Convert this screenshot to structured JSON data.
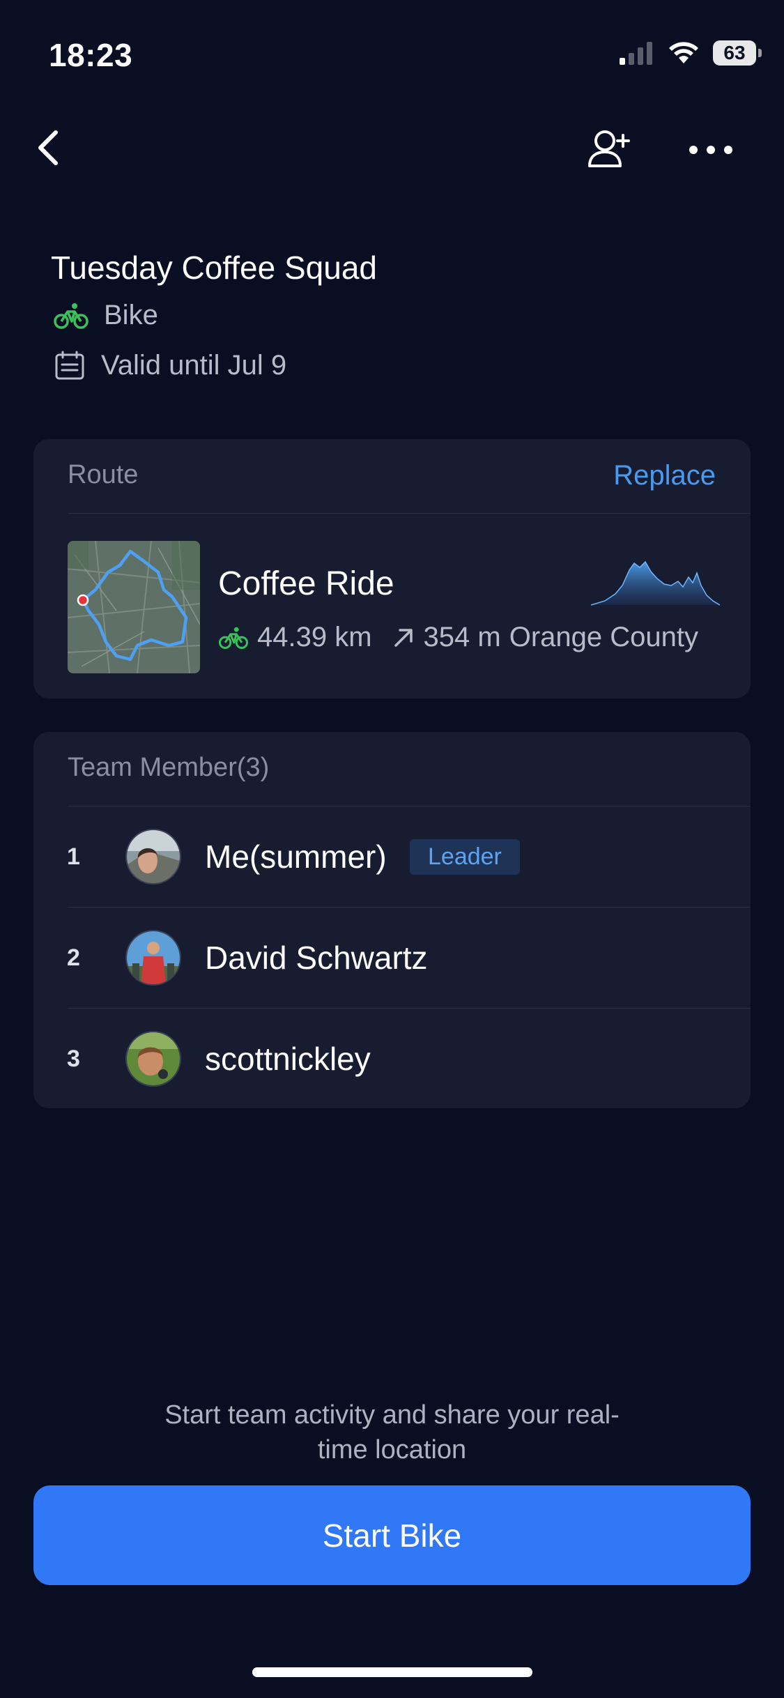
{
  "status_bar": {
    "time": "18:23",
    "battery": "63"
  },
  "header": {
    "title": "Tuesday Coffee Squad",
    "sport": "Bike",
    "valid_until": "Valid until Jul 9"
  },
  "route": {
    "heading": "Route",
    "replace_label": "Replace",
    "name": "Coffee Ride",
    "distance": "44.39 km",
    "elevation": "354 m",
    "region": "Orange County"
  },
  "team": {
    "heading": "Team Member(3)",
    "members": [
      {
        "index": "1",
        "name": "Me(summer)",
        "badge": "Leader"
      },
      {
        "index": "2",
        "name": "David Schwartz"
      },
      {
        "index": "3",
        "name": "scottnickley"
      }
    ]
  },
  "footer": {
    "note": "Start team activity and share your real-time location",
    "start_label": "Start Bike"
  },
  "colors": {
    "background": "#0a0e22",
    "card": "#181c30",
    "accent": "#3178f6",
    "link": "#4a9bf0",
    "bike_green": "#3ac15a"
  },
  "icons": [
    "back-icon",
    "add-user-icon",
    "more-icon",
    "bike-icon",
    "calendar-icon",
    "ascent-arrow-icon",
    "signal-icon",
    "wifi-icon",
    "battery-icon"
  ]
}
